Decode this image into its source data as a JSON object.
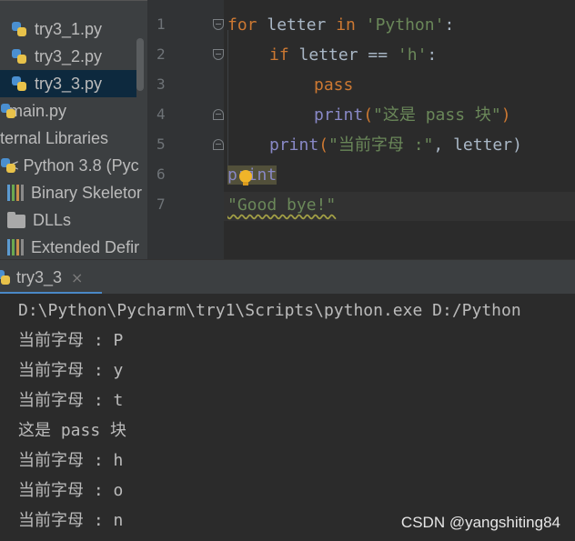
{
  "project_tree": {
    "items": [
      {
        "label": "try3_1.py",
        "icon": "python-file-icon"
      },
      {
        "label": "try3_2.py",
        "icon": "python-file-icon"
      },
      {
        "label": "try3_3.py",
        "icon": "python-file-icon",
        "selected": true
      },
      {
        "label": "main.py",
        "icon": "python-file-icon"
      },
      {
        "label": "ternal Libraries"
      },
      {
        "label": "< Python 3.8 (Pyc",
        "icon": "python-file-icon"
      },
      {
        "label": "Binary Skeletor",
        "icon": "library-icon"
      },
      {
        "label": "DLLs",
        "icon": "folder-icon"
      },
      {
        "label": "Extended Defir",
        "icon": "library-icon"
      }
    ]
  },
  "editor": {
    "line_numbers": [
      "1",
      "2",
      "3",
      "4",
      "5",
      "6",
      "7"
    ],
    "code": {
      "l1": {
        "kw1": "for",
        "t1": " letter ",
        "kw2": "in",
        "t2": " ",
        "s1": "'Python'",
        "t3": ":"
      },
      "l2": {
        "kw1": "if",
        "t1": " letter == ",
        "s1": "'h'",
        "t2": ":"
      },
      "l3": {
        "kw1": "pass"
      },
      "l4": {
        "fn": "print",
        "t1": "(",
        "s1": "\"这是 pass 块\"",
        "t2": ")"
      },
      "l5": {
        "fn": "print",
        "t1": "(",
        "s1": "\"当前字母 :\"",
        "t2": ", letter)"
      },
      "l6": {
        "text": "print"
      },
      "l7": {
        "s1": "\"Good bye!\""
      }
    }
  },
  "run_panel": {
    "tab_label": "try3_3",
    "close_glyph": "×",
    "console_lines": [
      "D:\\Python\\Pycharm\\try1\\Scripts\\python.exe D:/Python",
      "当前字母 : P",
      "当前字母 : y",
      "当前字母 : t",
      "这是 pass 块",
      "当前字母 : h",
      "当前字母 : o",
      "当前字母 : n"
    ]
  },
  "watermark": "CSDN @yangshiting84",
  "colors": {
    "background": "#2b2b2b",
    "keyword": "#cc7832",
    "string": "#6a8759",
    "builtin": "#8888c6",
    "selection": "#0d293e"
  }
}
